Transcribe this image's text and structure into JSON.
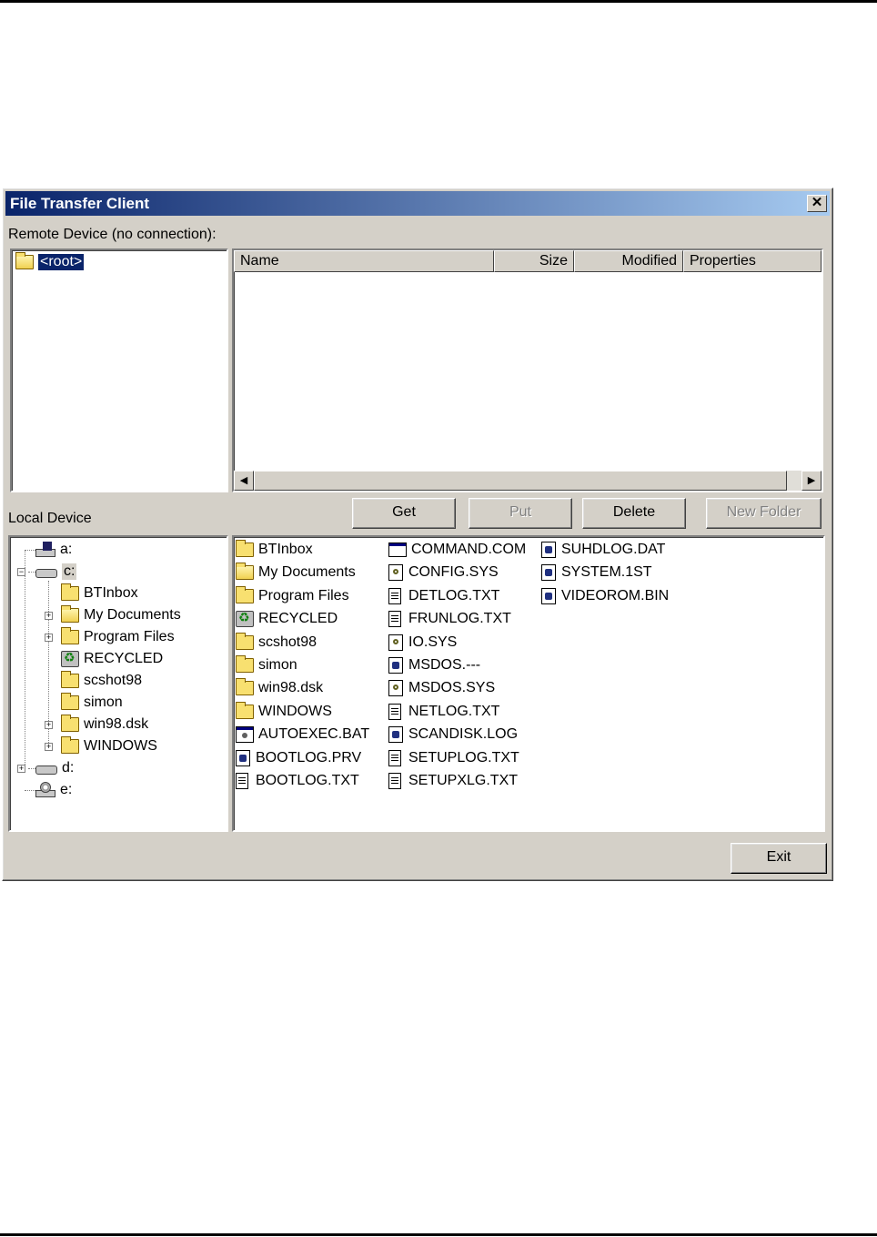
{
  "window": {
    "title": "File Transfer Client",
    "close_glyph": "✕"
  },
  "remote": {
    "label": "Remote Device (no connection):",
    "tree_root": "<root>",
    "columns": [
      "Name",
      "Size",
      "Modified",
      "Properties"
    ]
  },
  "local": {
    "label": "Local Device"
  },
  "buttons": {
    "get": "Get",
    "put": "Put",
    "delete": "Delete",
    "new_folder": "New Folder",
    "exit": "Exit"
  },
  "local_tree": {
    "a": "a:",
    "c": "c:",
    "d": "d:",
    "e": "e:",
    "children": [
      "BTInbox",
      "My Documents",
      "Program Files",
      "RECYCLED",
      "scshot98",
      "simon",
      "win98.dsk",
      "WINDOWS"
    ]
  },
  "local_files": {
    "col1": [
      "BTInbox",
      "My Documents",
      "Program Files",
      "RECYCLED",
      "scshot98",
      "simon",
      "win98.dsk",
      "WINDOWS",
      "AUTOEXEC.BAT",
      "BOOTLOG.PRV",
      "BOOTLOG.TXT"
    ],
    "col2": [
      "COMMAND.COM",
      "CONFIG.SYS",
      "DETLOG.TXT",
      "FRUNLOG.TXT",
      "IO.SYS",
      "MSDOS.---",
      "MSDOS.SYS",
      "NETLOG.TXT",
      "SCANDISK.LOG",
      "SETUPLOG.TXT",
      "SETUPXLG.TXT"
    ],
    "col3": [
      "SUHDLOG.DAT",
      "SYSTEM.1ST",
      "VIDEOROM.BIN"
    ]
  },
  "icons": {
    "col1": [
      "folder-icon",
      "folder-open-icon",
      "folder-icon",
      "recycle-bin-icon",
      "folder-icon",
      "folder-icon",
      "folder-icon",
      "folder-icon",
      "batch-file-icon",
      "system-file-icon",
      "text-file-icon"
    ],
    "col2": [
      "application-icon",
      "config-file-icon",
      "text-file-icon",
      "text-file-icon",
      "config-file-icon",
      "system-file-icon",
      "config-file-icon",
      "text-file-icon",
      "system-file-icon",
      "text-file-icon",
      "text-file-icon"
    ],
    "col3": [
      "system-file-icon",
      "system-file-icon",
      "system-file-icon"
    ]
  }
}
